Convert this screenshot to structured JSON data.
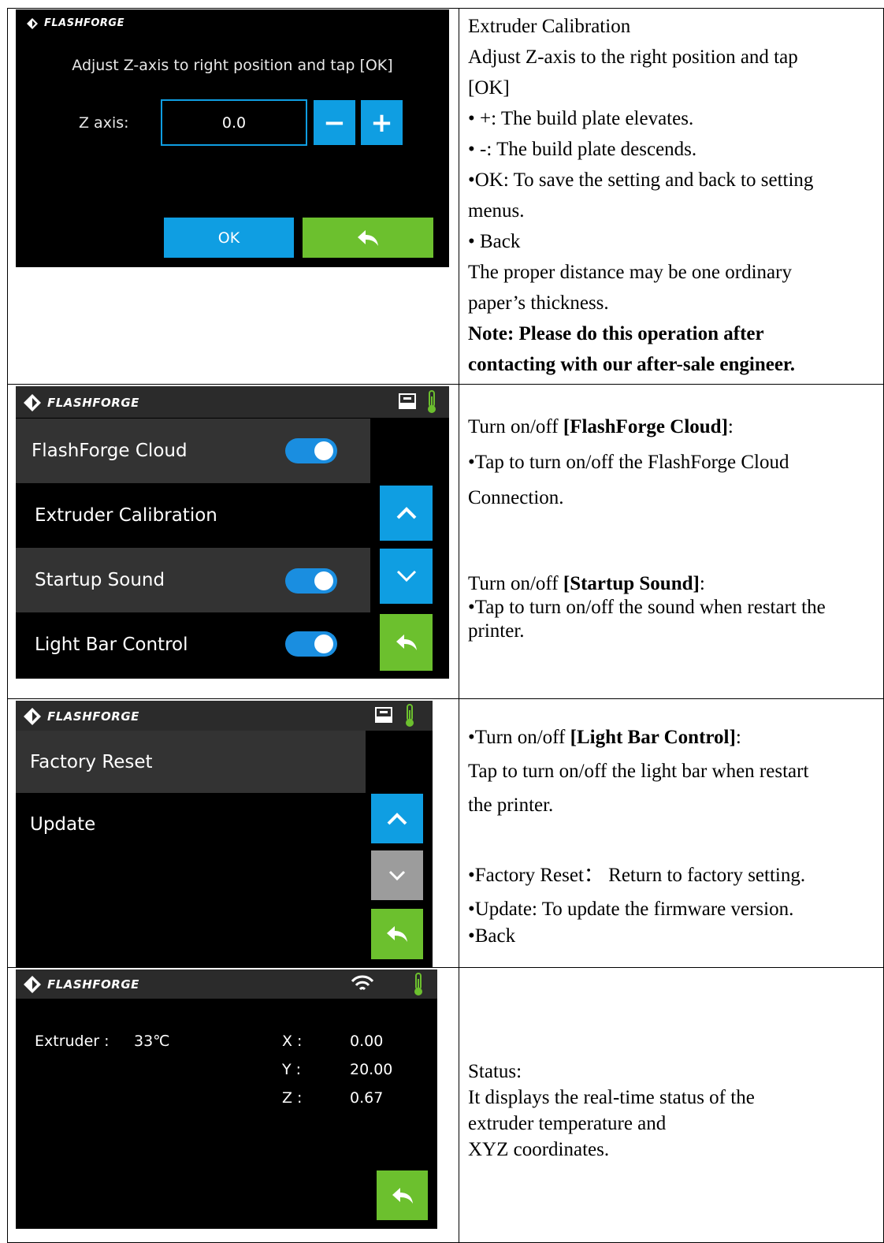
{
  "brand": "FLASHFORGE",
  "colors": {
    "blue": "#0f9ee2",
    "green": "#6cc02e",
    "grey": "#9c9c9c",
    "row_selected": "#333333",
    "topbar": "#2b2b2b"
  },
  "screen1": {
    "instruction": "Adjust Z-axis to right position and tap [OK]",
    "z_label": "Z axis:",
    "z_value": "0.0",
    "minus": "−",
    "plus": "+",
    "ok": "OK",
    "back_icon": "back-arrow-icon"
  },
  "screen2": {
    "icons": [
      "printer-icon",
      "thermometer-icon"
    ],
    "rows": [
      {
        "label": "FlashForge Cloud",
        "toggle": true,
        "selected": true
      },
      {
        "label": "Extruder Calibration",
        "toggle": false,
        "selected": false
      },
      {
        "label": "Startup Sound",
        "toggle": true,
        "selected": true
      },
      {
        "label": "Light Bar Control",
        "toggle": true,
        "selected": false
      }
    ]
  },
  "screen3": {
    "icons": [
      "printer-icon",
      "thermometer-icon"
    ],
    "rows": [
      {
        "label": "Factory Reset",
        "selected": true
      },
      {
        "label": "Update",
        "selected": false
      }
    ]
  },
  "screen4": {
    "icons": [
      "wifi-icon",
      "thermometer-icon"
    ],
    "extruder_label": "Extruder :",
    "extruder_value": "33℃",
    "x_label": "X :",
    "x_value": "0.00",
    "y_label": "Y :",
    "y_value": "20.00",
    "z_label": "Z :",
    "z_value": "0.67"
  },
  "desc1": {
    "title": "Extruder Calibration",
    "line1": "Adjust Z-axis to the right position and tap",
    "line2": "[OK]",
    "b1": "• +: The build plate elevates.",
    "b2": "• -: The build plate descends.",
    "b3": "•OK: To save the setting and back to setting",
    "b3b": "menus.",
    "b4": "• Back",
    "p1": "The proper distance may be one ordinary",
    "p2": "paper’s thickness.",
    "note1": "Note: Please do this operation after",
    "note2": "contacting with our after-sale engineer."
  },
  "desc2": {
    "cloud_pre": "Turn on/off ",
    "cloud_bold": "[FlashForge Cloud]",
    "cloud_post": ":",
    "cloud_l1": "•Tap to turn on/off the FlashForge Cloud",
    "cloud_l2": "Connection.",
    "sound_pre": "Turn on/off ",
    "sound_bold": "[Startup Sound]",
    "sound_post": ":",
    "sound_l1": "•Tap to turn on/off the sound when restart  the",
    "sound_l2": "printer."
  },
  "desc3": {
    "light_pre": "•Turn on/off ",
    "light_bold": "[Light Bar Control]",
    "light_post": ":",
    "light_l1": "Tap to turn on/off the light bar when restart",
    "light_l2": "the printer.",
    "reset": "•Factory Reset： Return to factory setting.",
    "update": "•Update: To update the firmware version.",
    "back": "•Back"
  },
  "desc4": {
    "title": "Status:",
    "l1": "It displays the real-time status of the",
    "l2": "extruder temperature and",
    "l3": "XYZ coordinates."
  }
}
